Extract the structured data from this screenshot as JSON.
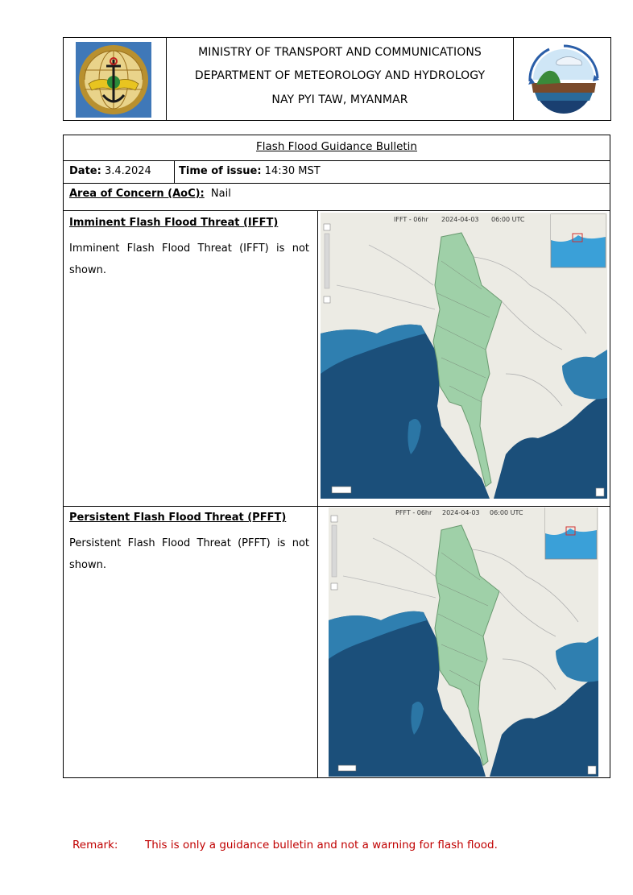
{
  "header": {
    "line1": "MINISTRY OF TRANSPORT AND COMMUNICATIONS",
    "line2": "DEPARTMENT OF METEOROLOGY AND HYDROLOGY",
    "line3": "NAY PYI TAW, MYANMAR"
  },
  "bulletin": {
    "title": "Flash Flood Guidance Bulletin",
    "date_label": "Date:",
    "date_value": "3.4.2024",
    "issue_label": "Time of issue:",
    "issue_value": "14:30 MST",
    "aoc_label": "Area of Concern (AoC):",
    "aoc_value": "Nail"
  },
  "ifft": {
    "heading": "Imminent Flash Flood Threat (IFFT)",
    "text": "Imminent Flash Flood Threat (IFFT) is not shown.",
    "map_label": "IFFT - 06hr",
    "map_date": "2024-04-03",
    "map_time": "06:00 UTC"
  },
  "pfft": {
    "heading": "Persistent Flash Flood Threat (PFFT)",
    "text": "Persistent Flash Flood Threat (PFFT) is not shown.",
    "map_label": "PFFT - 06hr",
    "map_date": "2024-04-03",
    "map_time": "06:00 UTC"
  },
  "remark": {
    "label": "Remark:",
    "text": "This is only a guidance bulletin and not a warning for flash flood."
  },
  "colors": {
    "remark": "#c00000",
    "sea_deep": "#1b4f7a",
    "sea_shallow": "#2f7fb0",
    "land": "#ecebe4",
    "basin": "#9fd0a8"
  }
}
